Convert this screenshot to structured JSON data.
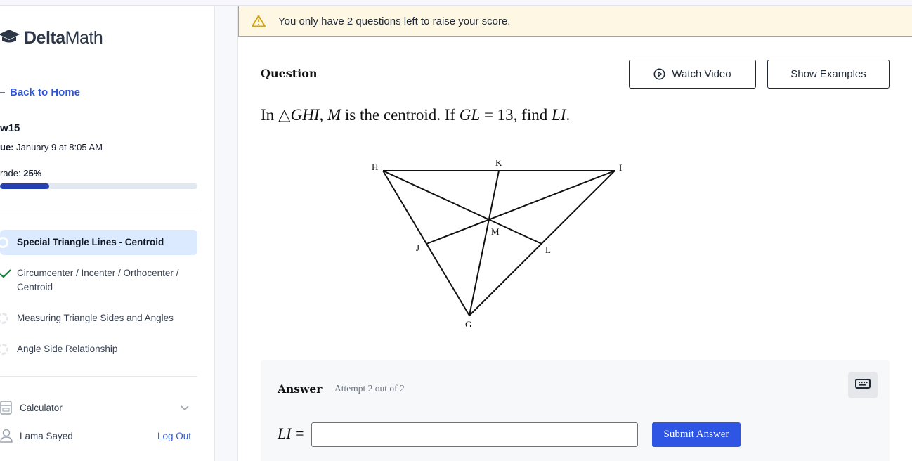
{
  "brand": {
    "name_bold": "Delta",
    "name_light": "Math"
  },
  "sidebar": {
    "back_label": "Back to Home",
    "assignment_name": "w15",
    "due_label": "ue:",
    "due_value": "January 9 at 8:05 AM",
    "grade_label": "rade:",
    "grade_value": "25%",
    "grade_fraction": 0.25,
    "skills": [
      {
        "label": "Special Triangle Lines - Centroid",
        "status": "in-progress",
        "active": true
      },
      {
        "label": "Circumcenter / Incenter / Orthocenter / Centroid",
        "status": "complete",
        "active": false
      },
      {
        "label": "Measuring Triangle Sides and Angles",
        "status": "not-started",
        "active": false
      },
      {
        "label": "Angle Side Relationship",
        "status": "not-started",
        "active": false
      }
    ],
    "calculator_label": "Calculator",
    "user_name": "Lama Sayed",
    "logout_label": "Log Out"
  },
  "alert": {
    "icon": "warning-icon",
    "text": "You only have 2 questions left to raise your score."
  },
  "question": {
    "heading": "Question",
    "watch_video_label": "Watch Video",
    "show_examples_label": "Show Examples",
    "text_parts": {
      "p1": "In △",
      "tri": "GHI",
      "p2": ", ",
      "centroid": "M",
      "p3": " is the centroid. If ",
      "given_seg": "GL",
      "p4": " = 13, find ",
      "find_seg": "LI",
      "p5": "."
    },
    "diagram_labels": {
      "H": "H",
      "K": "K",
      "I": "I",
      "M": "M",
      "J": "J",
      "L": "L",
      "G": "G"
    }
  },
  "answer": {
    "heading": "Answer",
    "attempt": "Attempt 2 out of 2",
    "lhs_var": "LI",
    "lhs_eq": " =",
    "input_value": "",
    "submit_label": "Submit Answer"
  }
}
